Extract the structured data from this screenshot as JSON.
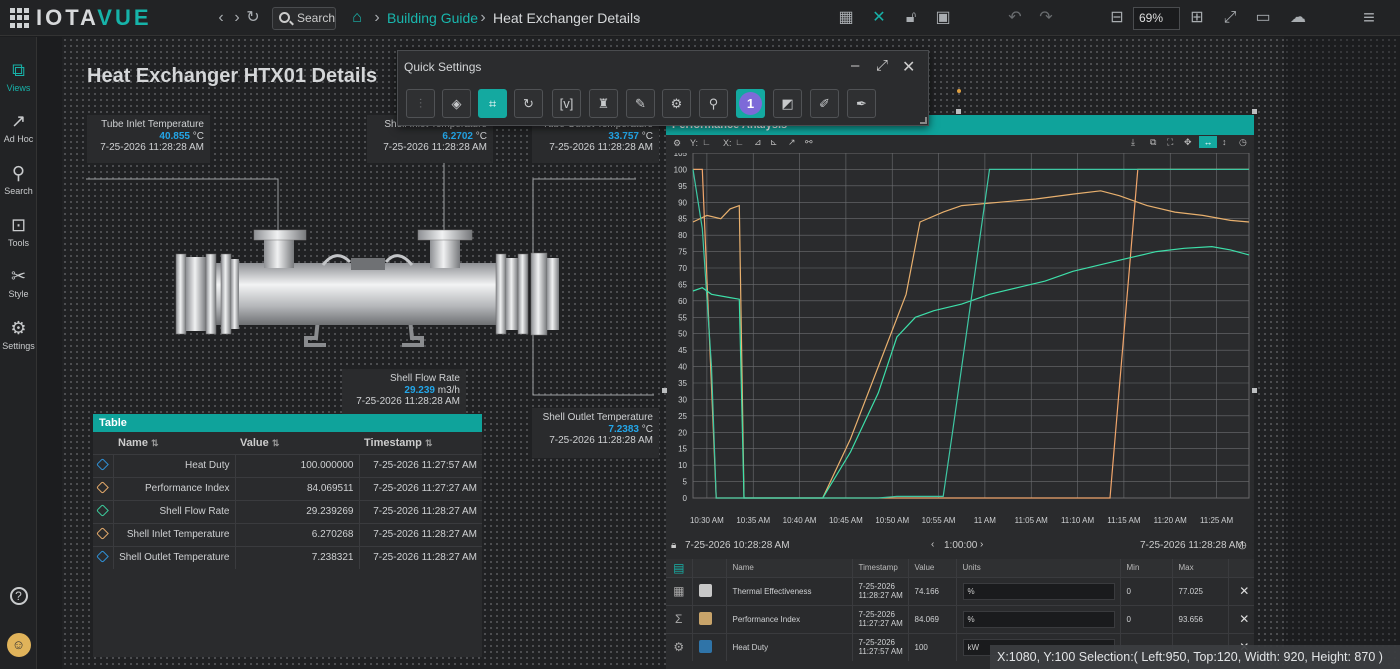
{
  "app": {
    "logo_main": "IOTA",
    "logo_accent": "VUE"
  },
  "topbar": {
    "search_label": "Search",
    "breadcrumbs": [
      "Building Guide",
      "Heat Exchanger Details"
    ],
    "zoom": "69%"
  },
  "sidebar": {
    "items": [
      {
        "label": "Views",
        "icon": "views-icon"
      },
      {
        "label": "Ad Hoc",
        "icon": "adhoc-icon"
      },
      {
        "label": "Search",
        "icon": "search-icon"
      },
      {
        "label": "Tools",
        "icon": "tools-icon"
      },
      {
        "label": "Style",
        "icon": "style-icon"
      },
      {
        "label": "Settings",
        "icon": "settings-icon"
      }
    ]
  },
  "page": {
    "title": "Heat Exchanger HTX01 Details"
  },
  "readouts": {
    "tube_inlet": {
      "label": "Tube Inlet Temperature",
      "value": "40.855",
      "unit": "°C",
      "time": "7-25-2026 11:28:28 AM"
    },
    "shell_inlet": {
      "label": "Shell Inlet Temperature",
      "value": "6.2702",
      "unit": "°C",
      "time": "7-25-2026 11:28:28 AM"
    },
    "tube_outlet": {
      "label": "Tube Outlet Temperature",
      "value": "33.757",
      "unit": "°C",
      "time": "7-25-2026 11:28:28 AM"
    },
    "shell_flow": {
      "label": "Shell Flow Rate",
      "value": "29.239",
      "unit": "m3/h",
      "time": "7-25-2026 11:28:28 AM"
    },
    "shell_outlet": {
      "label": "Shell Outlet Temperature",
      "value": "7.2383",
      "unit": "°C",
      "time": "7-25-2026 11:28:28 AM"
    }
  },
  "quick_settings": {
    "title": "Quick Settings",
    "badge": "1"
  },
  "table": {
    "title": "Table",
    "columns": [
      "Name",
      "Value",
      "Timestamp"
    ],
    "rows": [
      {
        "name": "Heat Duty",
        "value": "100.000000",
        "time": "7-25-2026 11:27:57 AM",
        "color": "#2f8fd3"
      },
      {
        "name": "Performance Index",
        "value": "84.069511",
        "time": "7-25-2026 11:27:27 AM",
        "color": "#e0a86a"
      },
      {
        "name": "Shell Flow Rate",
        "value": "29.239269",
        "time": "7-25-2026 11:28:27 AM",
        "color": "#3cc99a"
      },
      {
        "name": "Shell Inlet Temperature",
        "value": "6.270268",
        "time": "7-25-2026 11:28:27 AM",
        "color": "#e0a86a"
      },
      {
        "name": "Shell Outlet Temperature",
        "value": "7.238321",
        "time": "7-25-2026 11:28:27 AM",
        "color": "#2f8fd3"
      }
    ]
  },
  "chart_panel": {
    "title": "Performance Analysis",
    "footer_start": "7-25-2026 10:28:28 AM",
    "footer_span": "1:00:00",
    "footer_end": "7-25-2026 11:28:28 AM",
    "legend_columns": [
      "Name",
      "Timestamp",
      "Value",
      "Units",
      "Min",
      "Max"
    ],
    "legend_rows": [
      {
        "name": "Thermal Effectiveness",
        "ts1": "7-25-2026",
        "ts2": "11:28:27 AM",
        "value": "74.166",
        "units": "%",
        "min": "0",
        "max": "77.025",
        "color": "#c8c8c8"
      },
      {
        "name": "Performance Index",
        "ts1": "7-25-2026",
        "ts2": "11:27:27 AM",
        "value": "84.069",
        "units": "%",
        "min": "0",
        "max": "93.656",
        "color": "#c8a46a"
      },
      {
        "name": "Heat Duty",
        "ts1": "7-25-2026",
        "ts2": "11:27:57 AM",
        "value": "100",
        "units": "kW",
        "min": "",
        "max": "",
        "color": "#2f74a8"
      }
    ]
  },
  "chart_data": {
    "type": "line",
    "x_ticks": [
      "10:30 AM",
      "10:35 AM",
      "10:40 AM",
      "10:45 AM",
      "10:50 AM",
      "10:55 AM",
      "11 AM",
      "11:05 AM",
      "11:10 AM",
      "11:15 AM",
      "11:20 AM",
      "11:25 AM"
    ],
    "xlim_minutes": [
      0,
      60
    ],
    "ylim": [
      0,
      105
    ],
    "y_ticks": [
      0,
      5,
      10,
      15,
      20,
      25,
      30,
      35,
      40,
      45,
      50,
      55,
      60,
      65,
      70,
      75,
      80,
      85,
      90,
      95,
      100,
      105
    ],
    "grid": true,
    "series": [
      {
        "color": "#f0a56b",
        "points": [
          [
            0,
            100
          ],
          [
            1,
            100
          ],
          [
            2.5,
            0
          ],
          [
            45,
            0
          ],
          [
            48,
            100
          ],
          [
            60,
            100
          ]
        ]
      },
      {
        "color": "#e8b06e",
        "points": [
          [
            0,
            84
          ],
          [
            1.5,
            86
          ],
          [
            3,
            85
          ],
          [
            4,
            88
          ],
          [
            5,
            89
          ],
          [
            5.5,
            0
          ],
          [
            14,
            0
          ],
          [
            17,
            18
          ],
          [
            20,
            40
          ],
          [
            23,
            62
          ],
          [
            24.5,
            84
          ],
          [
            27,
            87
          ],
          [
            29,
            89
          ],
          [
            33,
            90
          ],
          [
            37,
            91
          ],
          [
            41,
            92.5
          ],
          [
            44,
            93.5
          ],
          [
            46,
            92
          ],
          [
            49,
            89
          ],
          [
            52,
            87
          ],
          [
            55,
            86
          ],
          [
            58,
            84.5
          ],
          [
            60,
            84
          ]
        ]
      },
      {
        "color": "#3ddfa9",
        "points": [
          [
            0,
            63
          ],
          [
            1,
            64
          ],
          [
            2,
            62
          ],
          [
            4,
            61
          ],
          [
            5,
            60.5
          ],
          [
            5.5,
            0
          ],
          [
            14,
            0
          ],
          [
            17,
            14
          ],
          [
            20,
            32
          ],
          [
            22,
            49
          ],
          [
            24,
            55
          ],
          [
            26,
            57
          ],
          [
            29,
            59
          ],
          [
            32,
            62
          ],
          [
            35,
            64
          ],
          [
            38,
            66
          ],
          [
            41,
            69
          ],
          [
            44,
            71
          ],
          [
            47,
            73
          ],
          [
            50,
            75
          ],
          [
            53,
            76
          ],
          [
            56,
            76.5
          ],
          [
            58,
            75.5
          ],
          [
            60,
            74
          ]
        ]
      },
      {
        "color": "#3ec7a3",
        "points": [
          [
            0,
            100
          ],
          [
            1,
            82
          ],
          [
            2,
            40
          ],
          [
            2.5,
            0
          ],
          [
            20,
            0
          ],
          [
            22,
            0.5
          ],
          [
            27,
            0.5
          ],
          [
            28,
            20
          ],
          [
            30,
            60
          ],
          [
            32,
            100
          ],
          [
            60,
            100
          ]
        ]
      }
    ]
  },
  "status": {
    "text": "X:1080, Y:100  Selection:( Left:950, Top:120, Width: 920, Height: 870 )"
  }
}
